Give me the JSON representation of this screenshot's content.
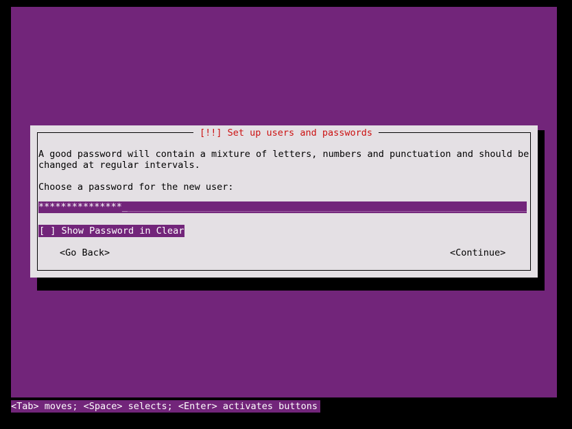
{
  "screen": {
    "background_color": "#000000",
    "canvas_color": "#72257a"
  },
  "dialog": {
    "title": "[!!] Set up users and passwords",
    "title_color": "#cc1111",
    "background_color": "#e4e0e4",
    "body": {
      "line1": "A good password will contain a mixture of letters, numbers and punctuation and should be",
      "line2": "changed at regular intervals.",
      "prompt": "Choose a password for the new user:"
    },
    "password_input": {
      "name": "password-input",
      "masked_value": "***************",
      "cursor": "_",
      "filler": "__________________________________________________________________________",
      "mask_char": "*",
      "char_count": 15,
      "focused": false,
      "field_color": "#72257a",
      "text_color": "#ffffff"
    },
    "show_password_checkbox": {
      "bracket": "[ ]",
      "checked": false,
      "label": "Show Password in Clear",
      "full_text": "[ ] Show Password in Clear",
      "selected": true,
      "highlight_color": "#72257a",
      "text_color": "#ffffff"
    },
    "buttons": {
      "go_back": "<Go Back>",
      "continue": "<Continue>"
    }
  },
  "help_bar": {
    "text": "<Tab> moves; <Space> selects; <Enter> activates buttons",
    "background_color": "#72257a",
    "text_color": "#ffffff"
  }
}
